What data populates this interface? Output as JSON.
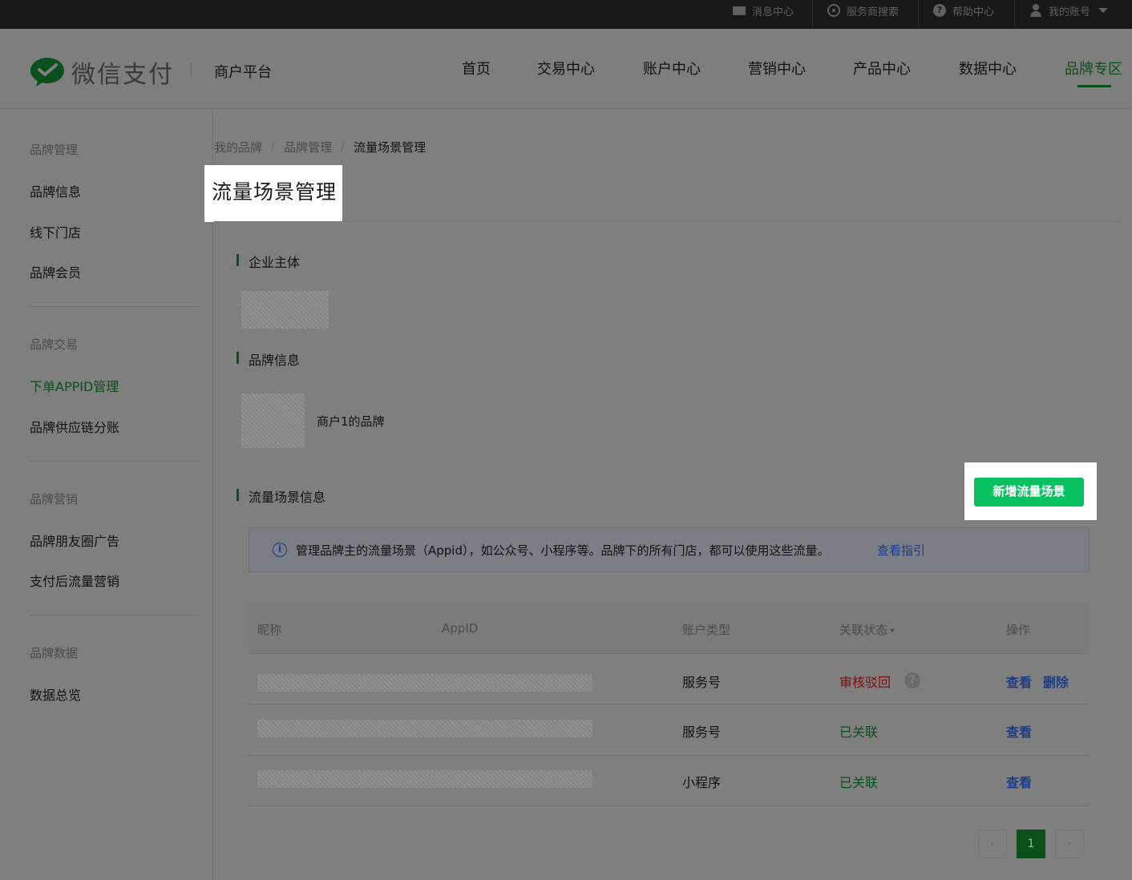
{
  "topbar": {
    "messages": "消息中心",
    "provider_search": "服务商搜索",
    "help": "帮助中心",
    "account": "我的账号"
  },
  "header": {
    "logo_text": "微信支付",
    "platform": "商户平台",
    "nav": [
      "首页",
      "交易中心",
      "账户中心",
      "营销中心",
      "产品中心",
      "数据中心",
      "品牌专区"
    ],
    "active_nav": "品牌专区"
  },
  "sidebar": {
    "groups": [
      {
        "title": "品牌管理",
        "items": [
          "品牌信息",
          "线下门店",
          "品牌会员"
        ]
      },
      {
        "title": "品牌交易",
        "items": [
          "下单APPID管理",
          "品牌供应链分账"
        ]
      },
      {
        "title": "品牌营销",
        "items": [
          "品牌朋友圈广告",
          "支付后流量营销"
        ]
      },
      {
        "title": "品牌数据",
        "items": [
          "数据总览"
        ]
      }
    ],
    "active_item": "下单APPID管理"
  },
  "breadcrumb": [
    "我的品牌",
    "品牌管理",
    "流量场景管理"
  ],
  "page_title": "流量场景管理",
  "sections": {
    "entity": "企业主体",
    "brand_info": "品牌信息",
    "brand_name": "商户1的品牌",
    "traffic": "流量场景信息"
  },
  "add_button": "新增流量场景",
  "notice": {
    "text": "管理品牌主的流量场景（Appid），如公众号、小程序等。品牌下的所有门店，都可以使用这些流量。",
    "link": "查看指引"
  },
  "table": {
    "headers": [
      "昵称",
      "AppID",
      "账户类型",
      "关联状态",
      "操作"
    ],
    "rows": [
      {
        "type": "服务号",
        "status": "审核驳回",
        "actions": [
          "查看",
          "删除"
        ]
      },
      {
        "type": "服务号",
        "status": "已关联",
        "actions": [
          "查看"
        ]
      },
      {
        "type": "小程序",
        "status": "已关联",
        "actions": [
          "查看"
        ]
      }
    ]
  },
  "pagination": {
    "prev": "‹",
    "current": "1",
    "next": "›"
  },
  "colors": {
    "accent_green": "#07c160",
    "overlay_gray": "#7f7f7f",
    "link_blue": "#1d3b86",
    "rejected_red": "#7a0d0d"
  }
}
